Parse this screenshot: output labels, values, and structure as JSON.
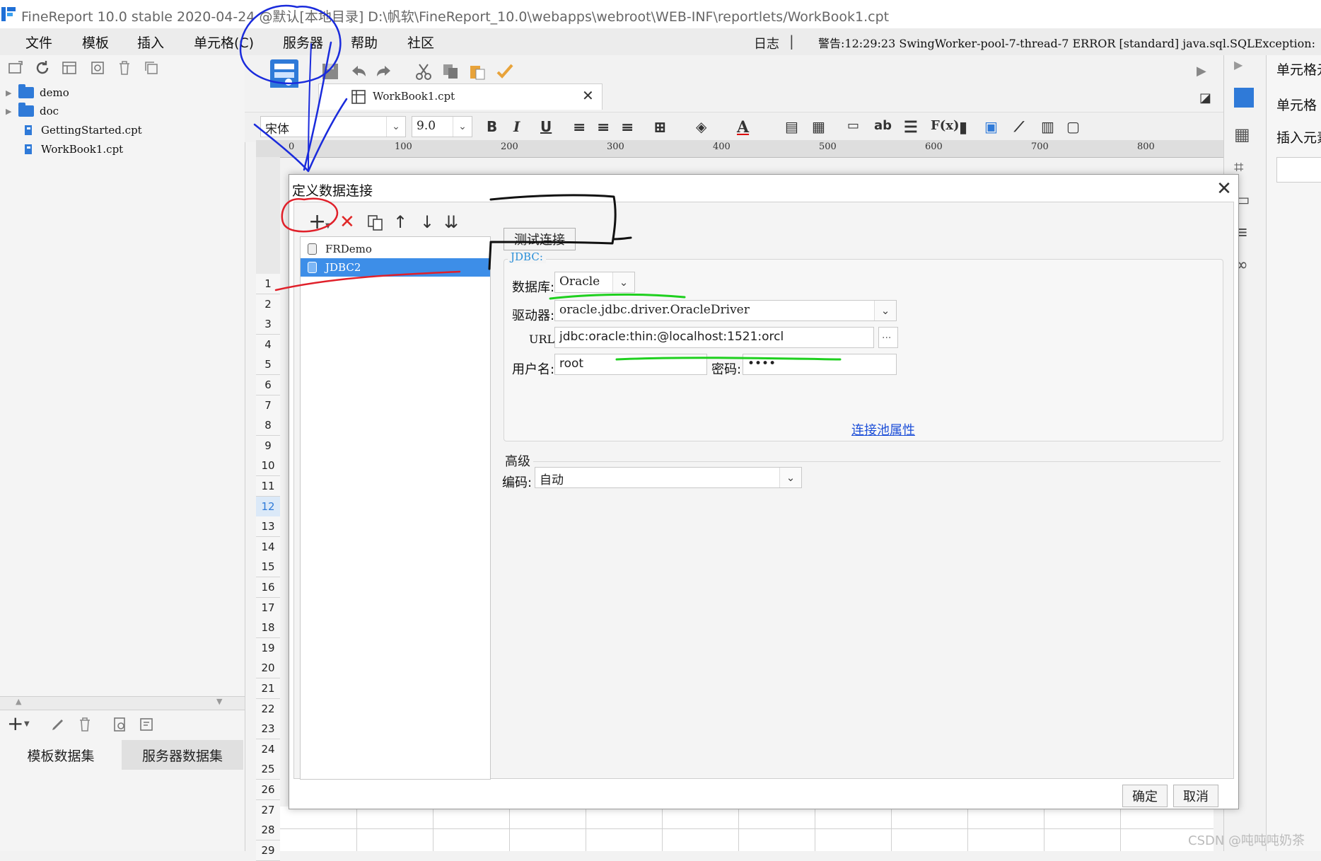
{
  "window": {
    "title": "FineReport 10.0 stable 2020-04-24 @默认[本地目录]    D:\\帆软\\FineReport_10.0\\webapps\\webroot\\WEB-INF\\reportlets/WorkBook1.cpt"
  },
  "menu": {
    "items": [
      "文件",
      "模板",
      "插入",
      "单元格(C)",
      "服务器",
      "帮助",
      "社区"
    ],
    "log_label": "日志",
    "status": "警告:12:29:23 SwingWorker-pool-7-thread-7 ERROR [standard] java.sql.SQLException:"
  },
  "tree": {
    "items": [
      "demo",
      "doc",
      "GettingStarted.cpt",
      "WorkBook1.cpt"
    ]
  },
  "datasets": {
    "tabs": [
      "模板数据集",
      "服务器数据集"
    ]
  },
  "document": {
    "tab_label": "WorkBook1.cpt"
  },
  "format": {
    "font_name": "宋体",
    "font_size": "9.0",
    "icon_labels": [
      "B",
      "I",
      "U",
      "ab",
      "F(x)"
    ]
  },
  "ruler": {
    "ticks": [
      "0",
      "100",
      "200",
      "300",
      "400",
      "500",
      "600",
      "700",
      "800"
    ]
  },
  "rows": [
    "1",
    "2",
    "3",
    "4",
    "5",
    "6",
    "7",
    "8",
    "9",
    "10",
    "11",
    "12",
    "13",
    "14",
    "15",
    "16",
    "17",
    "18",
    "19",
    "20",
    "21",
    "22",
    "23",
    "24",
    "25",
    "26",
    "27",
    "28",
    "29"
  ],
  "right_panel": {
    "items": [
      "单元格元",
      "单元格",
      "插入元素"
    ]
  },
  "dialog": {
    "title": "定义数据连接",
    "connections": [
      "FRDemo",
      "JDBC2"
    ],
    "test_button": "测试连接",
    "group_label": "JDBC:",
    "database_label": "数据库:",
    "database_value": "Oracle",
    "driver_label": "驱动器:",
    "driver_value": "oracle.jdbc.driver.OracleDriver",
    "url_label": "URL:",
    "url_value": "jdbc:oracle:thin:@localhost:1521:orcl",
    "url_more": "...",
    "username_label": "用户名:",
    "username_value": "root",
    "password_label": "密码:",
    "password_value": "••••",
    "pool_link": "连接池属性",
    "advanced_label": "高级",
    "encoding_label": "编码:",
    "encoding_value": "自动",
    "ok": "确定",
    "cancel": "取消"
  },
  "watermark": "CSDN @吨吨吨奶茶",
  "colors": {
    "selection": "#3d8ee8",
    "link": "#1d4fd8",
    "annotation_blue": "#1a2bdc",
    "annotation_red": "#e0202a",
    "annotation_green": "#1fd01f"
  }
}
